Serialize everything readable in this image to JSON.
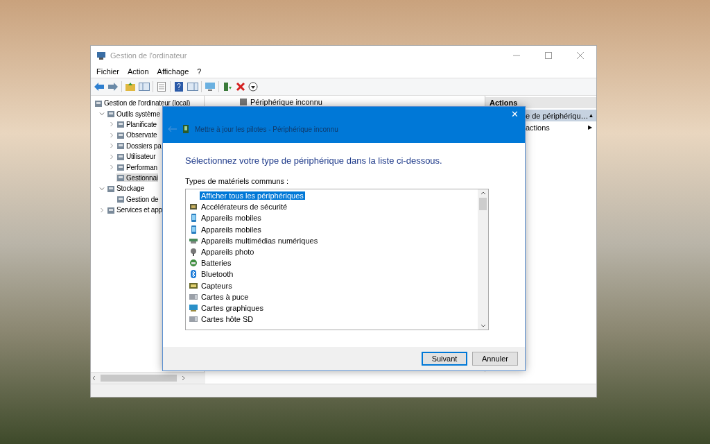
{
  "window": {
    "title": "Gestion de l'ordinateur"
  },
  "menu": [
    "Fichier",
    "Action",
    "Affichage",
    "?"
  ],
  "tree": [
    {
      "label": "Gestion de l'ordinateur (local)",
      "selected": false,
      "children": [
        {
          "label": "Outils système",
          "expanded": true,
          "selected": false,
          "children": [
            {
              "label": "Planificate",
              "expanded": false,
              "selected": false
            },
            {
              "label": "Observate",
              "expanded": false,
              "selected": false
            },
            {
              "label": "Dossiers pa",
              "expanded": false,
              "selected": false
            },
            {
              "label": "Utilisateur",
              "expanded": false,
              "selected": false
            },
            {
              "label": "Performan",
              "expanded": false,
              "selected": false
            },
            {
              "label": "Gestionnai",
              "selected": true
            }
          ]
        },
        {
          "label": "Stockage",
          "expanded": true,
          "selected": false,
          "children": [
            {
              "label": "Gestion de",
              "selected": false
            }
          ]
        },
        {
          "label": "Services et app",
          "expanded": false,
          "selected": false
        }
      ]
    }
  ],
  "middle_pane": {
    "header": "Périphérique inconnu"
  },
  "actions_pane": {
    "title": "Actions",
    "items": [
      {
        "label": "e de périphériqu…",
        "selected": true,
        "arrow": "▲"
      },
      {
        "label": "actions",
        "selected": false,
        "arrow": "▶"
      }
    ]
  },
  "dialog": {
    "title": "Mettre à jour les pilotes - Périphérique inconnu",
    "close": "✕",
    "heading": "Sélectionnez votre type de périphérique dans la liste ci-dessous.",
    "list_label": "Types de matériels communs :",
    "items": [
      {
        "label": "Afficher tous les périphériques",
        "kind": "none",
        "selected": true
      },
      {
        "label": "Accélérateurs de sécurité",
        "kind": "chip",
        "selected": false
      },
      {
        "label": "Appareils mobiles",
        "kind": "phone",
        "selected": false
      },
      {
        "label": "Appareils mobiles",
        "kind": "phone",
        "selected": false
      },
      {
        "label": "Appareils multimédias numériques",
        "kind": "media",
        "selected": false
      },
      {
        "label": "Appareils photo",
        "kind": "camera",
        "selected": false
      },
      {
        "label": "Batteries",
        "kind": "battery",
        "selected": false
      },
      {
        "label": "Bluetooth",
        "kind": "bluetooth",
        "selected": false
      },
      {
        "label": "Capteurs",
        "kind": "sensor",
        "selected": false
      },
      {
        "label": "Cartes à puce",
        "kind": "card",
        "selected": false
      },
      {
        "label": "Cartes graphiques",
        "kind": "display",
        "selected": false
      },
      {
        "label": "Cartes hôte SD",
        "kind": "card",
        "selected": false
      }
    ],
    "buttons": [
      {
        "label": "Suivant",
        "default": true
      },
      {
        "label": "Annuler",
        "default": false
      }
    ]
  }
}
